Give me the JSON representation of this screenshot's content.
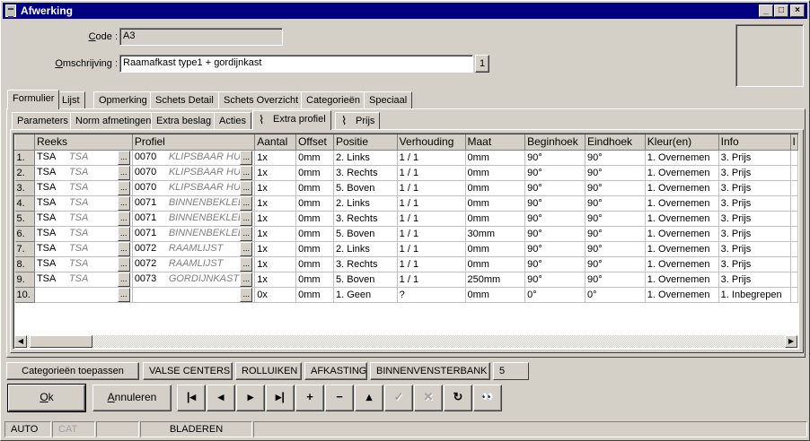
{
  "window": {
    "title": "Afwerking",
    "buttons": {
      "minimize": "_",
      "maximize": "□",
      "close": "×"
    }
  },
  "form": {
    "code_label_u": "C",
    "code_label_rest": "ode :",
    "code_value": "A3",
    "omschrijving_label_u": "O",
    "omschrijving_label_rest": "mschrijving :",
    "omschrijving_value": "Raamafkast type1 + gordijnkast",
    "lang_badge": "1"
  },
  "main_tabs": [
    "Formulier",
    "Lijst",
    "Opmerking",
    "Schets Detail",
    "Schets Overzicht",
    "Categorieën",
    "Speciaal"
  ],
  "sub_tabs": [
    "Parameters",
    "Norm afmetingen",
    "Extra beslag",
    "Acties",
    "Extra profiel",
    "Prijs"
  ],
  "grid": {
    "headers": [
      "Reeks",
      "Profiel",
      "Aantal",
      "Offset",
      "Positie",
      "Verhouding",
      "Maat",
      "Beginhoek",
      "Eindhoek",
      "Kleur(en)",
      "Info",
      "I"
    ],
    "rows": [
      {
        "n": "1.",
        "reeks": "TSA",
        "reeks_desc": "TSA",
        "profiel": "0070",
        "profiel_desc": "KLIPSBAAR HU(",
        "aantal": "1x",
        "offset": "0mm",
        "positie": "2. Links",
        "verhouding": "1 / 1",
        "maat": "0mm",
        "begin": "90°",
        "eind": "90°",
        "kleur": "1. Overnemen",
        "info": "3. Prijs"
      },
      {
        "n": "2.",
        "reeks": "TSA",
        "reeks_desc": "TSA",
        "profiel": "0070",
        "profiel_desc": "KLIPSBAAR HU(",
        "aantal": "1x",
        "offset": "0mm",
        "positie": "3. Rechts",
        "verhouding": "1 / 1",
        "maat": "0mm",
        "begin": "90°",
        "eind": "90°",
        "kleur": "1. Overnemen",
        "info": "3. Prijs"
      },
      {
        "n": "3.",
        "reeks": "TSA",
        "reeks_desc": "TSA",
        "profiel": "0070",
        "profiel_desc": "KLIPSBAAR HU(",
        "aantal": "1x",
        "offset": "0mm",
        "positie": "5. Boven",
        "verhouding": "1 / 1",
        "maat": "0mm",
        "begin": "90°",
        "eind": "90°",
        "kleur": "1. Overnemen",
        "info": "3. Prijs"
      },
      {
        "n": "4.",
        "reeks": "TSA",
        "reeks_desc": "TSA",
        "profiel": "0071",
        "profiel_desc": "BINNENBEKLED",
        "aantal": "1x",
        "offset": "0mm",
        "positie": "2. Links",
        "verhouding": "1 / 1",
        "maat": "0mm",
        "begin": "90°",
        "eind": "90°",
        "kleur": "1. Overnemen",
        "info": "3. Prijs"
      },
      {
        "n": "5.",
        "reeks": "TSA",
        "reeks_desc": "TSA",
        "profiel": "0071",
        "profiel_desc": "BINNENBEKLED",
        "aantal": "1x",
        "offset": "0mm",
        "positie": "3. Rechts",
        "verhouding": "1 / 1",
        "maat": "0mm",
        "begin": "90°",
        "eind": "90°",
        "kleur": "1. Overnemen",
        "info": "3. Prijs"
      },
      {
        "n": "6.",
        "reeks": "TSA",
        "reeks_desc": "TSA",
        "profiel": "0071",
        "profiel_desc": "BINNENBEKLED",
        "aantal": "1x",
        "offset": "0mm",
        "positie": "5. Boven",
        "verhouding": "1 / 1",
        "maat": "30mm",
        "begin": "90°",
        "eind": "90°",
        "kleur": "1. Overnemen",
        "info": "3. Prijs"
      },
      {
        "n": "7.",
        "reeks": "TSA",
        "reeks_desc": "TSA",
        "profiel": "0072",
        "profiel_desc": "RAAMLIJST",
        "aantal": "1x",
        "offset": "0mm",
        "positie": "2. Links",
        "verhouding": "1 / 1",
        "maat": "0mm",
        "begin": "90°",
        "eind": "90°",
        "kleur": "1. Overnemen",
        "info": "3. Prijs"
      },
      {
        "n": "8.",
        "reeks": "TSA",
        "reeks_desc": "TSA",
        "profiel": "0072",
        "profiel_desc": "RAAMLIJST",
        "aantal": "1x",
        "offset": "0mm",
        "positie": "3. Rechts",
        "verhouding": "1 / 1",
        "maat": "0mm",
        "begin": "90°",
        "eind": "90°",
        "kleur": "1. Overnemen",
        "info": "3. Prijs"
      },
      {
        "n": "9.",
        "reeks": "TSA",
        "reeks_desc": "TSA",
        "profiel": "0073",
        "profiel_desc": "GORDIJNKAST",
        "aantal": "1x",
        "offset": "0mm",
        "positie": "5. Boven",
        "verhouding": "1 / 1",
        "maat": "250mm",
        "begin": "90°",
        "eind": "90°",
        "kleur": "1. Overnemen",
        "info": "3. Prijs"
      },
      {
        "n": "10.",
        "reeks": "",
        "reeks_desc": "",
        "profiel": "",
        "profiel_desc": "",
        "aantal": "0x",
        "offset": "0mm",
        "positie": "1. Geen",
        "verhouding": "?",
        "maat": "0mm",
        "begin": "0°",
        "eind": "0°",
        "kleur": "1. Overnemen",
        "info": "1. Inbegrepen"
      }
    ],
    "ellipsis": "..."
  },
  "filters": {
    "apply_label": "Categorieën toepassen",
    "categories": [
      "VALSE CENTERS",
      "ROLLUIKEN",
      "AFKASTING",
      "BINNENVENSTERBANK"
    ],
    "count": "5"
  },
  "buttons": {
    "ok_u": "O",
    "ok_rest": "k",
    "cancel_u": "A",
    "cancel_rest": "nnuleren"
  },
  "status": {
    "mode1": "AUTO",
    "mode2": "CAT",
    "mode3": "",
    "state": "BLADEREN"
  },
  "icons": {
    "first": "|◂",
    "prev": "◂",
    "next": "▸",
    "last": "▸|",
    "add": "+",
    "remove": "−",
    "up": "▴",
    "confirm": "✓",
    "cancel": "✕",
    "refresh": "↻",
    "search": "👀"
  }
}
